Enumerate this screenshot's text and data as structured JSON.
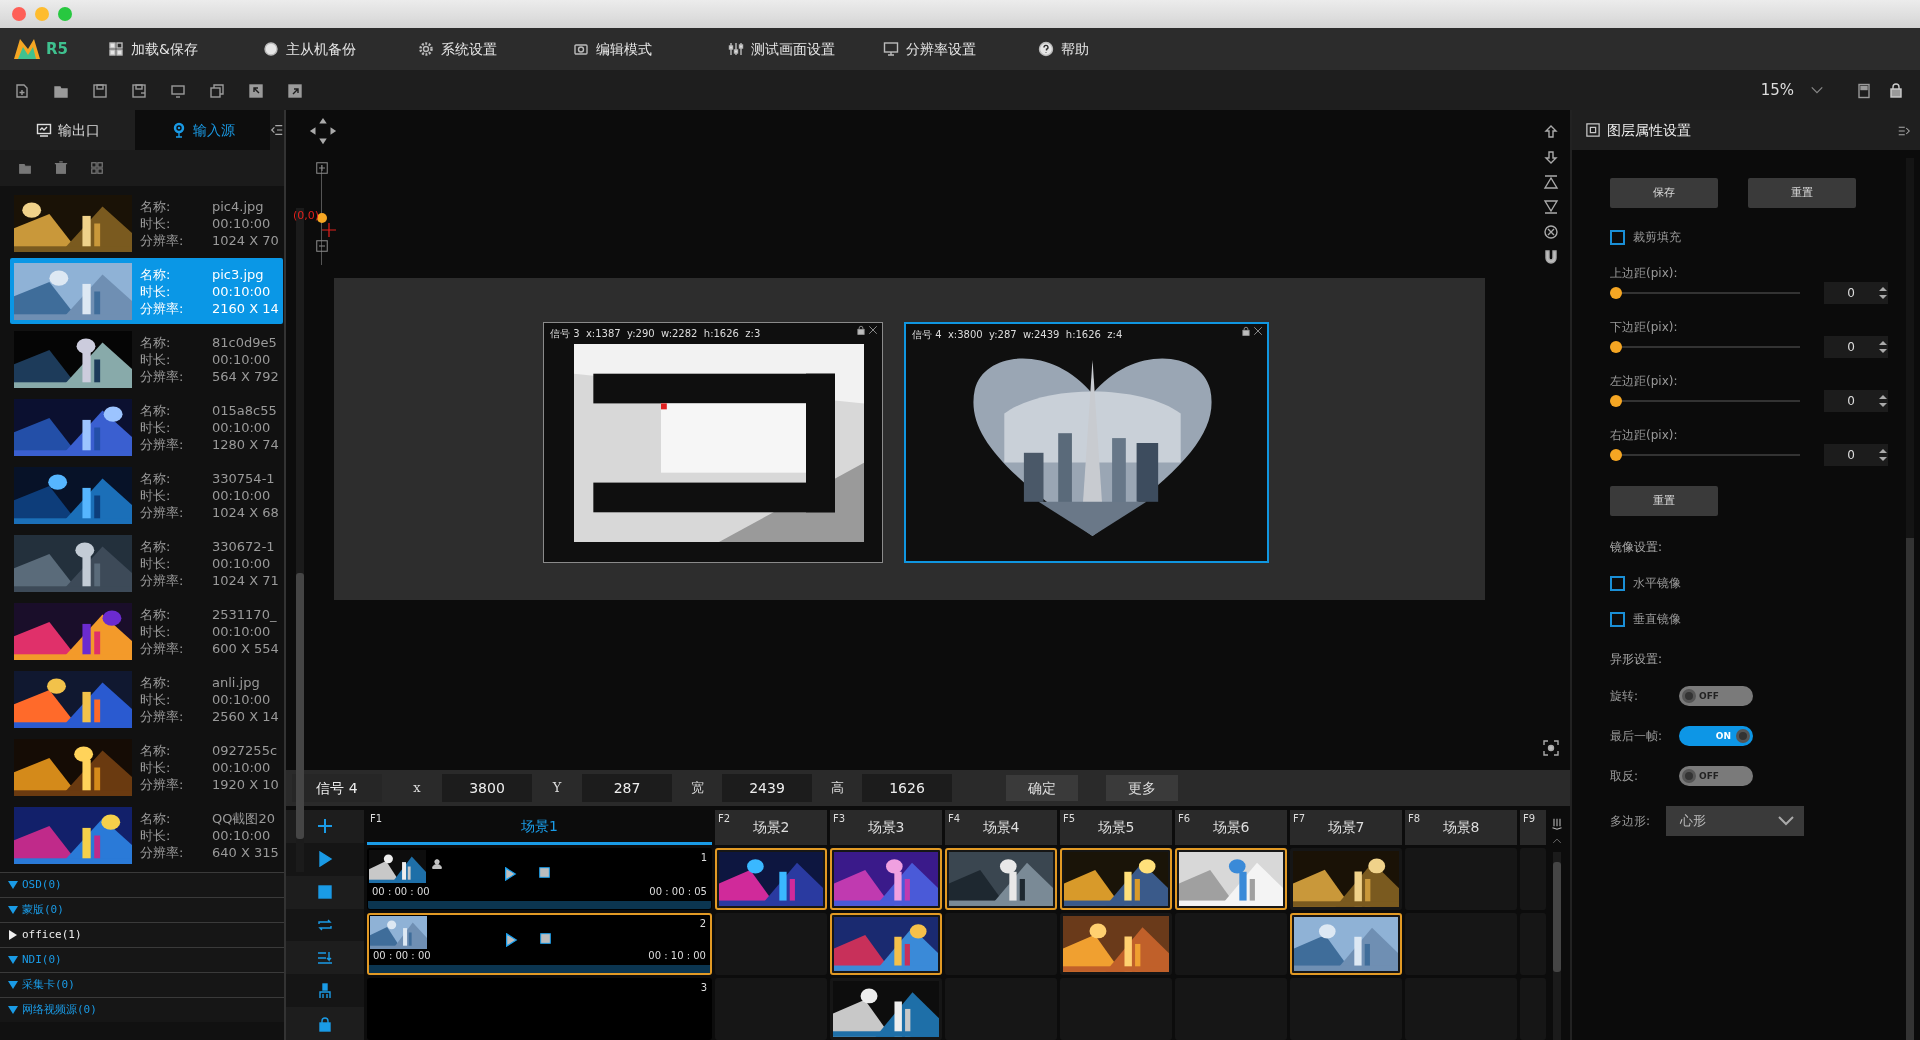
{
  "logo": {
    "text": "R5"
  },
  "menu": [
    {
      "label": "加载&保存"
    },
    {
      "label": "主从机备份"
    },
    {
      "label": "系统设置"
    },
    {
      "label": "编辑模式"
    },
    {
      "label": "测试画面设置"
    },
    {
      "label": "分辨率设置"
    },
    {
      "label": "帮助"
    }
  ],
  "zoom": {
    "value": "15%"
  },
  "left_panel": {
    "tabs": [
      {
        "label": "输出口",
        "selected": false
      },
      {
        "label": "输入源",
        "selected": true
      }
    ],
    "media": [
      {
        "selected": false,
        "fields": [
          {
            "label": "名称:",
            "value": "pic4.jpg"
          },
          {
            "label": "时长:",
            "value": "00:10:00"
          },
          {
            "label": "分辨率:",
            "value": "1024 X 70"
          }
        ]
      },
      {
        "selected": true,
        "fields": [
          {
            "label": "名称:",
            "value": "pic3.jpg"
          },
          {
            "label": "时长:",
            "value": "00:10:00"
          },
          {
            "label": "分辨率:",
            "value": "2160 X 14"
          }
        ]
      },
      {
        "selected": false,
        "fields": [
          {
            "label": "名称:",
            "value": "81c0d9e5"
          },
          {
            "label": "时长:",
            "value": "00:10:00"
          },
          {
            "label": "分辨率:",
            "value": "564 X 792"
          }
        ]
      },
      {
        "selected": false,
        "fields": [
          {
            "label": "名称:",
            "value": "015a8c55"
          },
          {
            "label": "时长:",
            "value": "00:10:00"
          },
          {
            "label": "分辨率:",
            "value": "1280 X 74"
          }
        ]
      },
      {
        "selected": false,
        "fields": [
          {
            "label": "名称:",
            "value": "330754-1"
          },
          {
            "label": "时长:",
            "value": "00:10:00"
          },
          {
            "label": "分辨率:",
            "value": "1024 X 68"
          }
        ]
      },
      {
        "selected": false,
        "fields": [
          {
            "label": "名称:",
            "value": "330672-1"
          },
          {
            "label": "时长:",
            "value": "00:10:00"
          },
          {
            "label": "分辨率:",
            "value": "1024 X 71"
          }
        ]
      },
      {
        "selected": false,
        "fields": [
          {
            "label": "名称:",
            "value": "2531170_"
          },
          {
            "label": "时长:",
            "value": "00:10:00"
          },
          {
            "label": "分辨率:",
            "value": "600 X 554"
          }
        ]
      },
      {
        "selected": false,
        "fields": [
          {
            "label": "名称:",
            "value": "anli.jpg"
          },
          {
            "label": "时长:",
            "value": "00:10:00"
          },
          {
            "label": "分辨率:",
            "value": "2560 X 14"
          }
        ]
      },
      {
        "selected": false,
        "fields": [
          {
            "label": "名称:",
            "value": "0927255c"
          },
          {
            "label": "时长:",
            "value": "00:10:00"
          },
          {
            "label": "分辨率:",
            "value": "1920 X 10"
          }
        ]
      },
      {
        "selected": false,
        "fields": [
          {
            "label": "名称:",
            "value": "QQ截图20"
          },
          {
            "label": "时长:",
            "value": "00:10:00"
          },
          {
            "label": "分辨率:",
            "value": "640 X 315"
          }
        ]
      }
    ],
    "categories": [
      {
        "label": "OSD(0)",
        "expanded": true
      },
      {
        "label": "蒙版(0)",
        "expanded": true
      },
      {
        "label": "office(1)",
        "expanded": false
      },
      {
        "label": "NDI(0)",
        "expanded": true
      },
      {
        "label": "采集卡(0)",
        "expanded": true
      },
      {
        "label": "网络视频源(0)",
        "expanded": true
      }
    ]
  },
  "canvas": {
    "origin_label": "(0,0)",
    "layers": [
      {
        "caption": "信号 3  x:1387  y:290  w:2282  h:1626  z:3",
        "kind": "rect",
        "selected": false
      },
      {
        "caption": "信号 4  x:3800  y:287  w:2439  h:1626  z:4",
        "kind": "heart",
        "selected": true
      }
    ]
  },
  "signal_bar": {
    "signal": "信号 4",
    "fields": [
      {
        "label": "x",
        "value": "3800"
      },
      {
        "label": "Y",
        "value": "287"
      },
      {
        "label": "宽",
        "value": "2439"
      },
      {
        "label": "高",
        "value": "1626"
      }
    ],
    "buttons": [
      "确定",
      "更多"
    ]
  },
  "scenes": [
    {
      "key": "F1",
      "label": "场景1",
      "selected": true,
      "cells": [
        {
          "kind": "clip",
          "number": "1",
          "start": "00 : 00 : 00",
          "end": "00 : 00 : 05",
          "person": true,
          "selected": false
        },
        {
          "kind": "clip",
          "number": "2",
          "start": "00 : 00 : 00",
          "end": "00 : 10 : 00",
          "person": false,
          "selected": true
        },
        {
          "kind": "blank",
          "number": "3",
          "selected": false
        }
      ]
    },
    {
      "key": "F2",
      "label": "场景2",
      "selected": false,
      "cells": [
        {
          "kind": "picture",
          "selected": true
        },
        {
          "kind": "empty",
          "selected": false
        },
        {
          "kind": "empty",
          "selected": false
        }
      ]
    },
    {
      "key": "F3",
      "label": "场景3",
      "selected": false,
      "cells": [
        {
          "kind": "picture",
          "selected": true
        },
        {
          "kind": "picture",
          "selected": true
        },
        {
          "kind": "picture",
          "selected": false
        }
      ]
    },
    {
      "key": "F4",
      "label": "场景4",
      "selected": false,
      "cells": [
        {
          "kind": "picture",
          "selected": true
        },
        {
          "kind": "empty",
          "selected": false
        },
        {
          "kind": "empty",
          "selected": false
        }
      ]
    },
    {
      "key": "F5",
      "label": "场景5",
      "selected": false,
      "cells": [
        {
          "kind": "picture",
          "selected": true
        },
        {
          "kind": "picture",
          "selected": false
        },
        {
          "kind": "empty",
          "selected": false
        }
      ]
    },
    {
      "key": "F6",
      "label": "场景6",
      "selected": false,
      "cells": [
        {
          "kind": "picture",
          "selected": true
        },
        {
          "kind": "empty",
          "selected": false
        },
        {
          "kind": "empty",
          "selected": false
        }
      ]
    },
    {
      "key": "F7",
      "label": "场景7",
      "selected": false,
      "cells": [
        {
          "kind": "picture",
          "selected": false
        },
        {
          "kind": "picture",
          "selected": true
        },
        {
          "kind": "empty",
          "selected": false
        }
      ]
    },
    {
      "key": "F8",
      "label": "场景8",
      "selected": false,
      "cells": [
        {
          "kind": "empty",
          "selected": false
        },
        {
          "kind": "empty",
          "selected": false
        },
        {
          "kind": "empty",
          "selected": false
        }
      ]
    },
    {
      "key": "F9",
      "selected": false,
      "cells": [
        {
          "kind": "empty",
          "selected": false
        },
        {
          "kind": "empty",
          "selected": false
        },
        {
          "kind": "empty",
          "selected": false
        }
      ]
    }
  ],
  "properties": {
    "title": "图层属性设置",
    "buttons": [
      "保存",
      "重置"
    ],
    "crop_fill": {
      "label": "裁剪填充",
      "checked": false
    },
    "margins": [
      {
        "label": "上边距(pix):",
        "level": 0,
        "value": "0"
      },
      {
        "label": "下边距(pix):",
        "level": 0,
        "value": "0"
      },
      {
        "label": "左边距(pix):",
        "level": 0,
        "value": "0"
      },
      {
        "label": "右边距(pix):",
        "level": 0,
        "value": "0"
      }
    ],
    "reset_button": "重置",
    "mirror_title": "镜像设置:",
    "mirror": [
      {
        "label": "水平镜像",
        "checked": false
      },
      {
        "label": "垂直镜像",
        "checked": false
      }
    ],
    "shape_title": "异形设置:",
    "toggles": [
      {
        "label": "旋转:",
        "on": false,
        "text": "OFF"
      },
      {
        "label": "最后一帧:",
        "on": true,
        "text": "ON"
      },
      {
        "label": "取反:",
        "on": false,
        "text": "OFF"
      }
    ],
    "polygon": {
      "label": "多边形:",
      "value": "心形"
    }
  }
}
